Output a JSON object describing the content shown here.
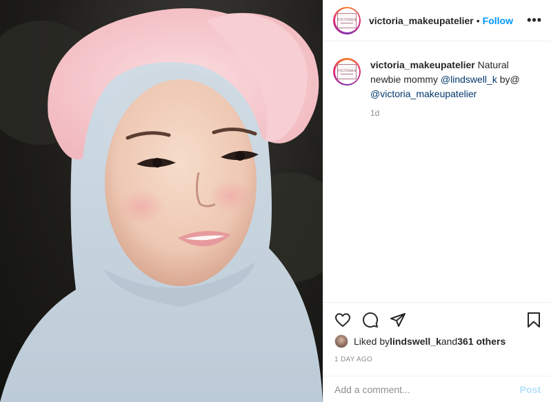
{
  "post": {
    "username": "victoria_makeupatelier",
    "follow_label": "Follow",
    "separator": "•",
    "more_label": "•••",
    "logo_text": "VICTORIA"
  },
  "caption": {
    "username": "victoria_makeupatelier",
    "text_part1": " Natural newbie mommy ",
    "mention1": "@lindswell_k",
    "text_part2": " by@ ",
    "mention2": "@victoria_makeupatelier",
    "time": "1d"
  },
  "actions": {
    "icons": [
      "heart-icon",
      "comment-icon",
      "share-icon",
      "bookmark-icon"
    ]
  },
  "likes": {
    "prefix": "Liked by ",
    "user": "lindswell_k",
    "middle": " and ",
    "others": "361 others"
  },
  "date": "1 DAY AGO",
  "comment": {
    "placeholder": "Add a comment...",
    "post_label": "Post"
  },
  "colors": {
    "follow_blue": "#0095f6",
    "mention_blue": "#00376b",
    "post_disabled": "#b2dffc",
    "muted": "#8e8e8e"
  }
}
